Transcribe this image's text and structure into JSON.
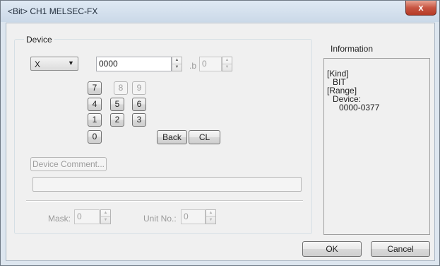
{
  "window": {
    "title": "<Bit> CH1 MELSEC-FX",
    "close_glyph": "x"
  },
  "device_group": {
    "legend": "Device"
  },
  "device_type": {
    "value": "X",
    "arrow": "▼"
  },
  "device_number": {
    "value": "0000"
  },
  "bit_suffix": {
    "label": ".b",
    "value": "0"
  },
  "keypad": {
    "keys": [
      "7",
      "8",
      "9",
      "4",
      "5",
      "6",
      "1",
      "2",
      "3",
      "0"
    ],
    "back_label": "Back",
    "clear_label": "CL"
  },
  "device_comment": {
    "label": "Device Comment..."
  },
  "mask": {
    "label": "Mask:",
    "value": "0"
  },
  "unit_no": {
    "label": "Unit No.:",
    "value": "0"
  },
  "information": {
    "label": "Information",
    "kind_header": "[Kind]",
    "kind_value": "BIT",
    "range_header": "[Range]",
    "device_label": "Device:",
    "device_range": "0000-0377"
  },
  "buttons": {
    "ok": "OK",
    "cancel": "Cancel"
  },
  "spin": {
    "up": "▲",
    "down": "▼"
  }
}
